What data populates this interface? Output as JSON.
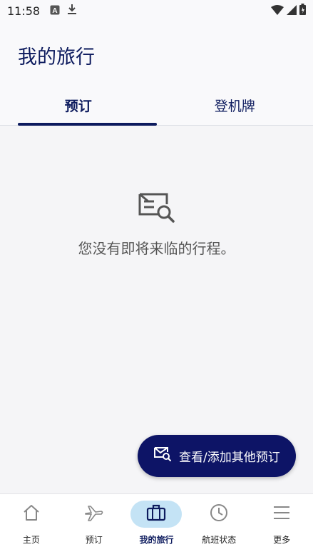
{
  "status_bar": {
    "time": "11:58",
    "icons": [
      "a-badge-icon",
      "download-icon",
      "wifi-icon",
      "cellular-icon",
      "battery-icon"
    ]
  },
  "header": {
    "title": "我的旅行"
  },
  "tabs": [
    {
      "label": "预订",
      "active": true
    },
    {
      "label": "登机牌",
      "active": false
    }
  ],
  "empty_state": {
    "icon": "envelope-search-icon",
    "message": "您没有即将来临的行程。"
  },
  "fab": {
    "icon": "envelope-search-icon",
    "label": "查看/添加其他预订"
  },
  "bottom_nav": [
    {
      "label": "主页",
      "icon": "home-icon",
      "active": false
    },
    {
      "label": "预订",
      "icon": "plane-icon",
      "active": false
    },
    {
      "label": "我的旅行",
      "icon": "briefcase-icon",
      "active": true
    },
    {
      "label": "航班状态",
      "icon": "clock-icon",
      "active": false
    },
    {
      "label": "更多",
      "icon": "menu-icon",
      "active": false
    }
  ],
  "colors": {
    "primary": "#0d1b5e",
    "fab": "#0d1466",
    "nav_active_bg": "#c4e3f5",
    "background": "#f5f5f7"
  }
}
